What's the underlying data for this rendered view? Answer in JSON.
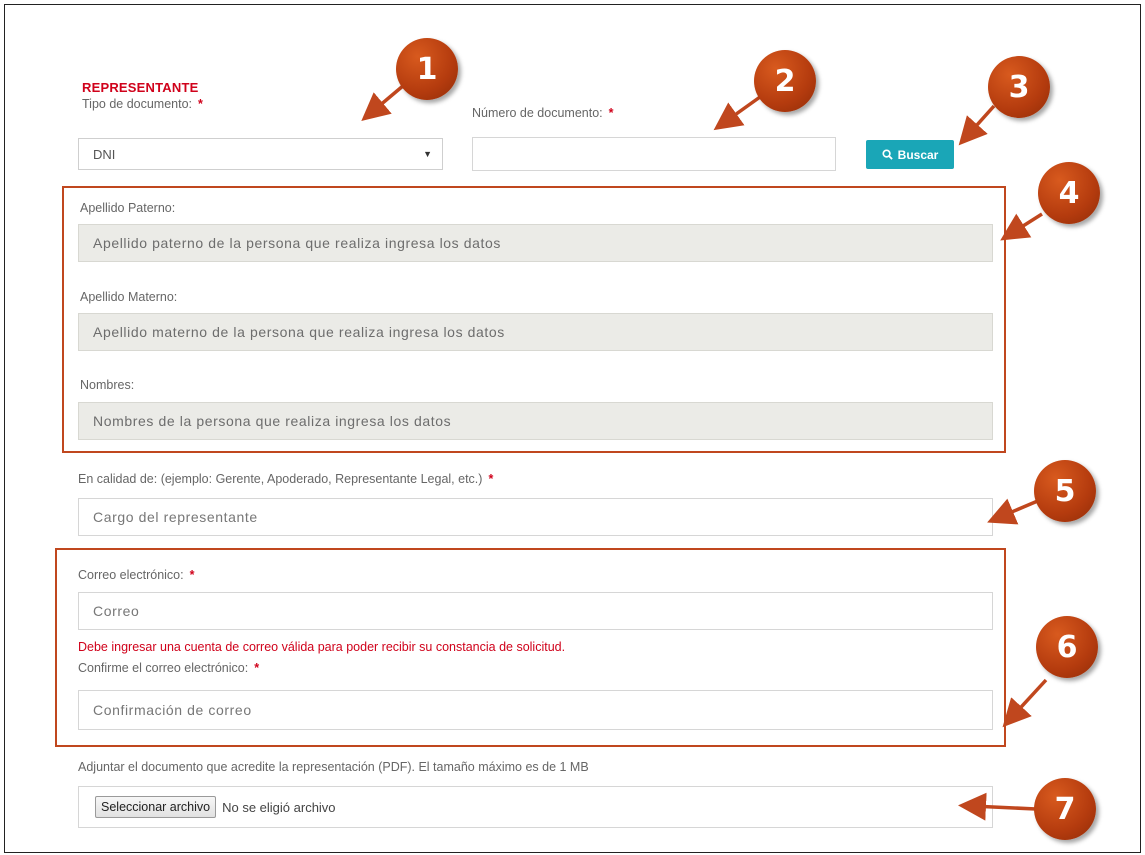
{
  "section": {
    "title": "REPRESENTANTE"
  },
  "required_mark": "*",
  "tipo_documento": {
    "label": "Tipo de documento:",
    "selected": "DNI"
  },
  "numero_documento": {
    "label": "Número de documento:",
    "value": ""
  },
  "buscar_button": {
    "label": "Buscar",
    "icon": "search-icon"
  },
  "apellido_paterno": {
    "label": "Apellido Paterno:",
    "placeholder": "Apellido paterno de la persona que realiza ingresa los datos"
  },
  "apellido_materno": {
    "label": "Apellido Materno:",
    "placeholder": "Apellido materno de la persona que realiza ingresa los datos"
  },
  "nombres": {
    "label": "Nombres:",
    "placeholder": "Nombres de la persona que realiza ingresa los datos"
  },
  "calidad": {
    "label": "En calidad de: (ejemplo: Gerente, Apoderado, Representante Legal, etc.)",
    "placeholder": "Cargo del representante"
  },
  "correo": {
    "label": "Correo electrónico:",
    "placeholder": "Correo",
    "warning": "Debe ingresar una cuenta de correo válida para poder recibir su constancia de solicitud."
  },
  "confirmar_correo": {
    "label": "Confirme el correo electrónico:",
    "placeholder": "Confirmación de correo"
  },
  "adjunto": {
    "label": "Adjuntar el documento que acredite la representación (PDF). El tamaño máximo es de 1 MB",
    "button": "Seleccionar archivo",
    "status": "No se eligió archivo"
  },
  "callouts": [
    "1",
    "2",
    "3",
    "4",
    "5",
    "6",
    "7"
  ],
  "colors": {
    "accent_red": "#d0021b",
    "button_teal": "#1aa6b7",
    "callout_orange": "#c0471e"
  }
}
